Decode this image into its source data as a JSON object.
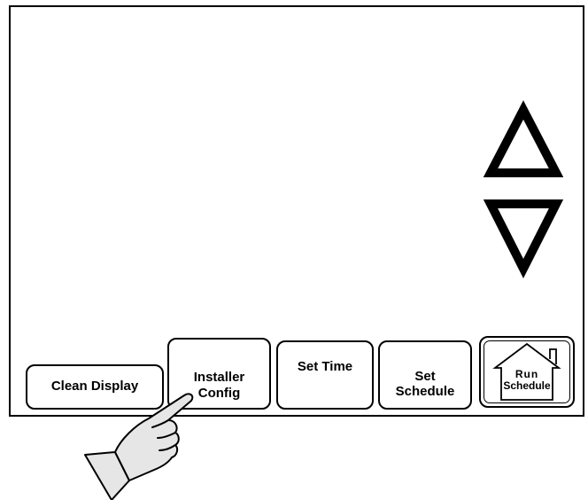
{
  "colors": {
    "stroke": "#000000",
    "background": "#ffffff",
    "hand_fill": "#e6e6e6"
  },
  "icons": {
    "up": "triangle-up-icon",
    "down": "triangle-down-icon",
    "home": "house-icon",
    "pointer": "pointing-hand-icon"
  },
  "buttons": {
    "clean_display": "Clean Display",
    "installer_config": [
      "Installer",
      "Config"
    ],
    "set_time": "Set Time",
    "set_schedule": [
      "Set",
      "Schedule"
    ],
    "run_schedule": [
      "Run",
      "Schedule"
    ]
  }
}
